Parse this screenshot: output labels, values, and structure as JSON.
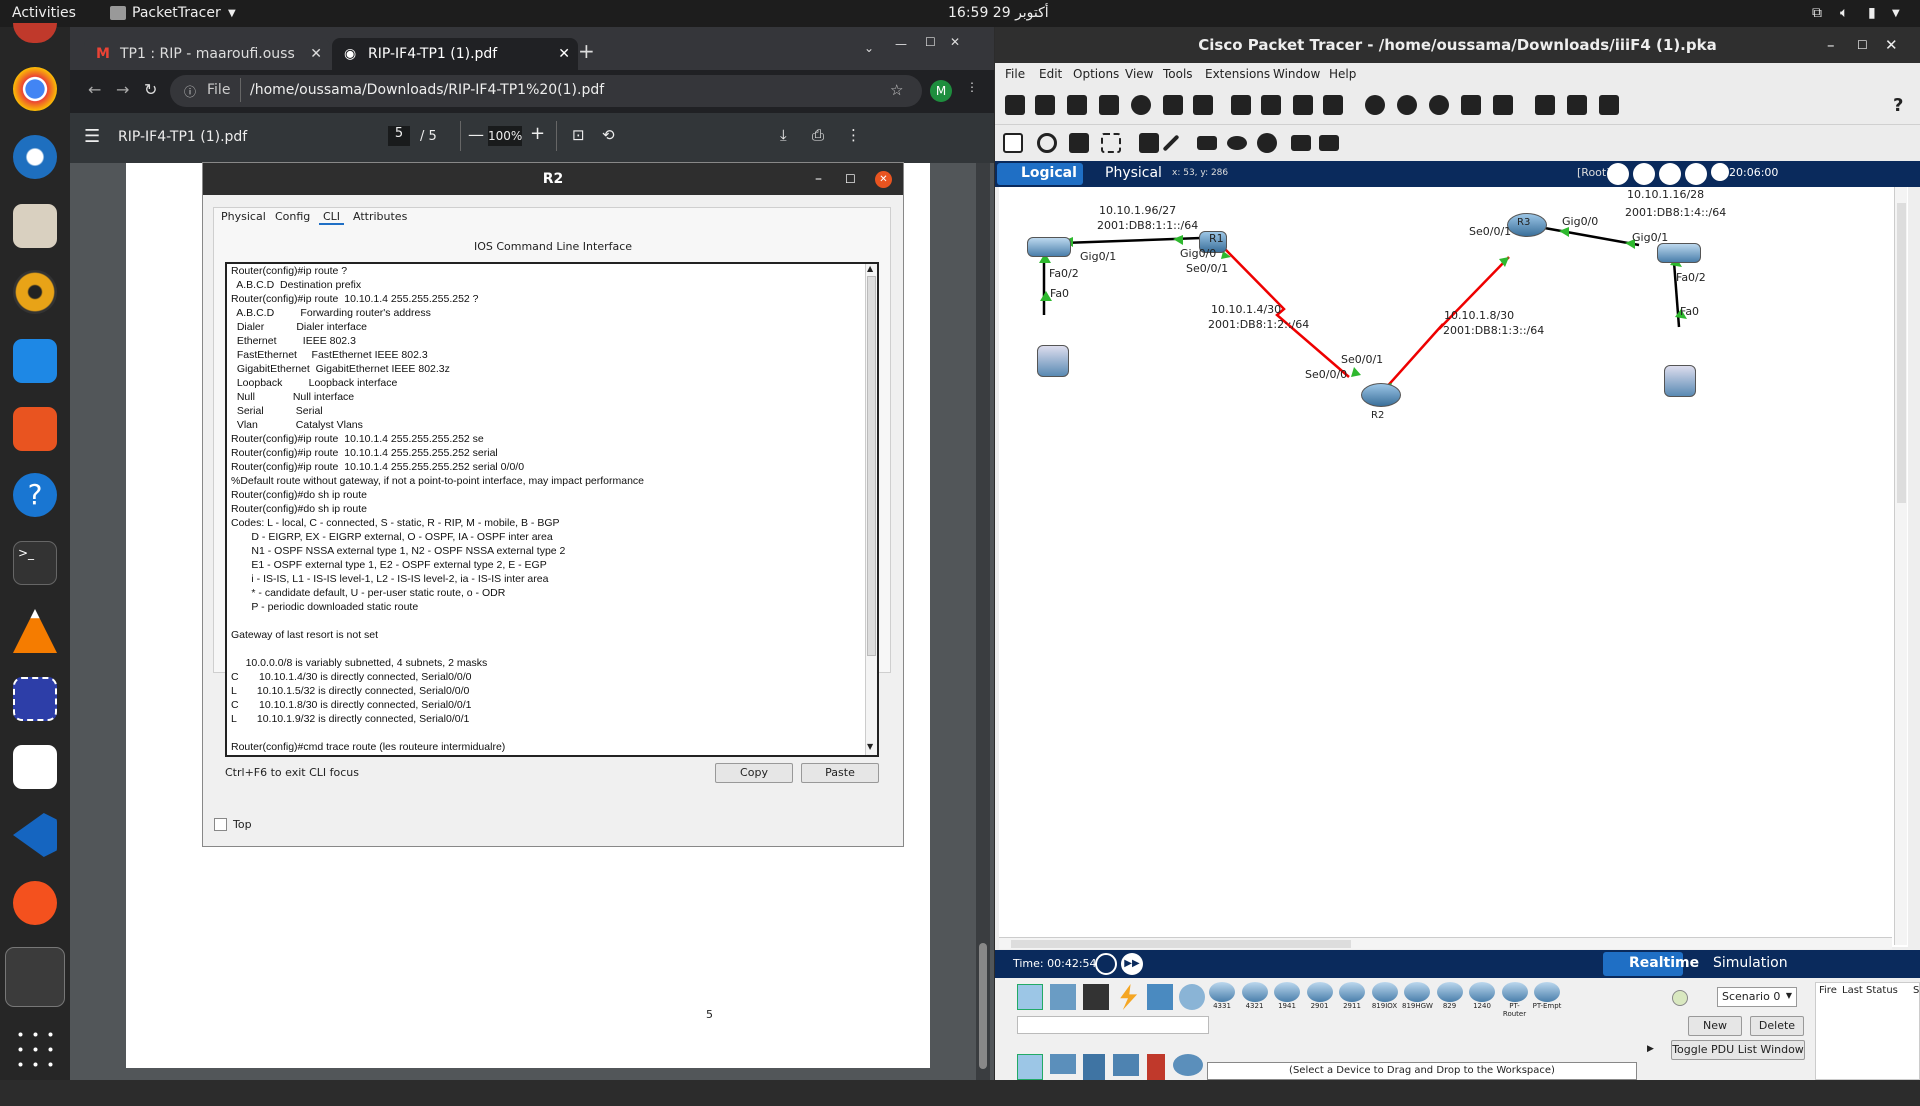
{
  "topbar": {
    "activities": "Activities",
    "app": "PacketTracer",
    "datetime": "16:59  29 أكتوبر"
  },
  "browser": {
    "tabs": [
      {
        "label": "TP1 : RIP - maaroufi.ouss"
      },
      {
        "label": "RIP-IF4-TP1 (1).pdf"
      }
    ],
    "address_prefix": "File",
    "url": "/home/oussama/Downloads/RIP-IF4-TP1%20(1).pdf",
    "profile": "M",
    "pdf": {
      "title": "RIP-IF4-TP1 (1).pdf",
      "page": "5",
      "total": "/  5",
      "zoom": "100%",
      "page_number_label": "5"
    }
  },
  "dialog": {
    "title": "R2",
    "tabs": [
      "Physical",
      "Config",
      "CLI",
      "Attributes"
    ],
    "section_title": "IOS Command Line Interface",
    "cli_lines": [
      "Router(config)#ip route ?",
      "  A.B.C.D  Destination prefix",
      "Router(config)#ip route  10.10.1.4 255.255.255.252 ?",
      "  A.B.C.D         Forwarding router's address",
      "  Dialer           Dialer interface",
      "  Ethernet         IEEE 802.3",
      "  FastEthernet     FastEthernet IEEE 802.3",
      "  GigabitEthernet  GigabitEthernet IEEE 802.3z",
      "  Loopback         Loopback interface",
      "  Null             Null interface",
      "  Serial           Serial",
      "  Vlan             Catalyst Vlans",
      "Router(config)#ip route  10.10.1.4 255.255.255.252 se",
      "Router(config)#ip route  10.10.1.4 255.255.255.252 serial",
      "Router(config)#ip route  10.10.1.4 255.255.255.252 serial 0/0/0",
      "%Default route without gateway, if not a point-to-point interface, may impact performance",
      "Router(config)#do sh ip route",
      "Router(config)#do sh ip route",
      "Codes: L - local, C - connected, S - static, R - RIP, M - mobile, B - BGP",
      "       D - EIGRP, EX - EIGRP external, O - OSPF, IA - OSPF inter area",
      "       N1 - OSPF NSSA external type 1, N2 - OSPF NSSA external type 2",
      "       E1 - OSPF external type 1, E2 - OSPF external type 2, E - EGP",
      "       i - IS-IS, L1 - IS-IS level-1, L2 - IS-IS level-2, ia - IS-IS inter area",
      "       * - candidate default, U - per-user static route, o - ODR",
      "       P - periodic downloaded static route",
      "",
      "Gateway of last resort is not set",
      "",
      "     10.0.0.0/8 is variably subnetted, 4 subnets, 2 masks",
      "C       10.10.1.4/30 is directly connected, Serial0/0/0",
      "L       10.10.1.5/32 is directly connected, Serial0/0/0",
      "C       10.10.1.8/30 is directly connected, Serial0/0/1",
      "L       10.10.1.9/32 is directly connected, Serial0/0/1",
      "",
      "Router(config)#cmd trace route (les routeure intermidualre)"
    ],
    "hint": "Ctrl+F6 to exit CLI focus",
    "copy_label": "Copy",
    "paste_label": "Paste",
    "top_label": "Top"
  },
  "pt": {
    "title": "Cisco Packet Tracer - /home/oussama/Downloads/iiiF4 (1).pka",
    "menu": [
      "File",
      "Edit",
      "Options",
      "View",
      "Tools",
      "Extensions",
      "Window",
      "Help"
    ],
    "logical": "Logical",
    "physical": "Physical",
    "coords": "x: 53, y: 286",
    "root": "[Root]",
    "clock": "20:06:00",
    "topology_labels": {
      "net1": "10.10.1.96/27",
      "net1v6": "2001:DB8:1:1::/64",
      "r1": "R1",
      "gig00": "Gig0/0",
      "gig01a": "Gig0/1",
      "se001a": "Se0/0/1",
      "fa02a": "Fa0/2",
      "fa0a": "Fa0",
      "net2": "10.10.1.4/30",
      "net2v6": "2001:DB8:1:2::/64",
      "net3": "10.10.1.8/30",
      "net3v6": "2001:DB8:1:3::/64",
      "r2": "R2",
      "se001b": "Se0/0/1",
      "se000": "Se0/0/0",
      "r3": "R3",
      "se001c": "Se0/0/1",
      "gig00c": "Gig0/0",
      "net4": "10.10.1.16/28",
      "net4v6": "2001:DB8:1:4::/64",
      "gig01b": "Gig0/1",
      "fa02b": "Fa0/2",
      "fa0b": "Fa0"
    },
    "time": "Time: 00:42:54",
    "realtime": "Realtime",
    "simulation": "Simulation",
    "devices": [
      "4331",
      "4321",
      "1941",
      "2901",
      "2911",
      "819IOX",
      "819HGW",
      "829",
      "1240",
      "PT-Router",
      "PT-Empt"
    ],
    "scenario": "Scenario 0",
    "new_label": "New",
    "delete_label": "Delete",
    "toggle_label": "Toggle PDU List Window",
    "fire": "Fire",
    "last_status": "Last Status",
    "s": "S",
    "hint": "(Select a Device to Drag and Drop to the Workspace)"
  }
}
